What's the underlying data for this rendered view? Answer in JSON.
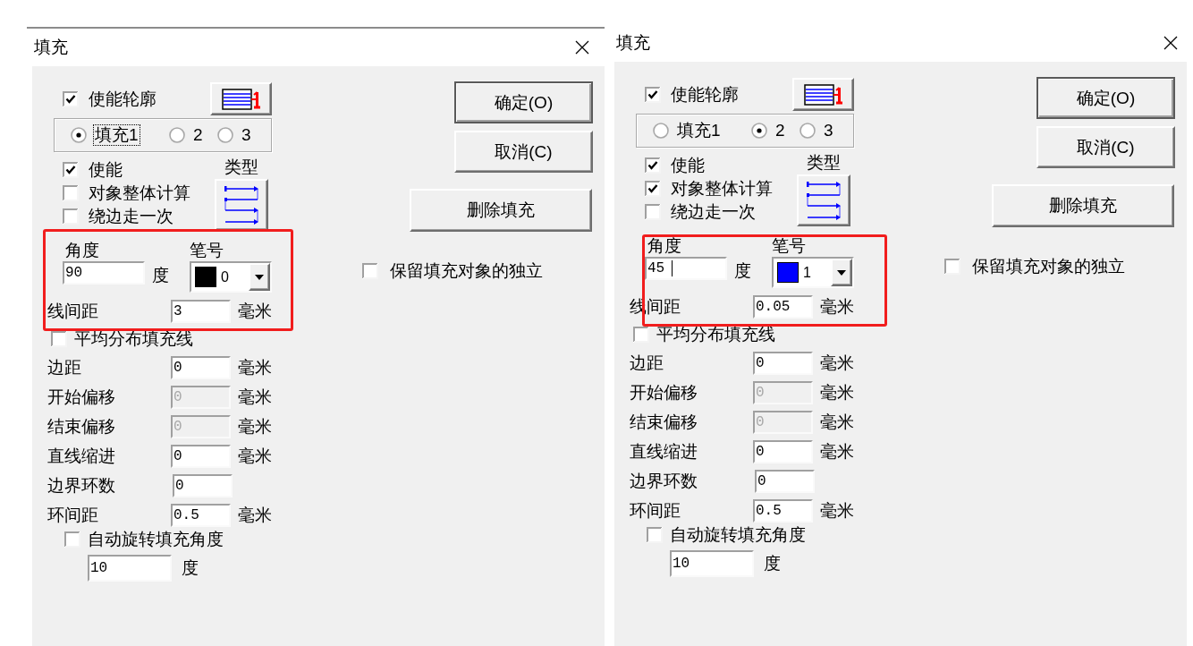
{
  "dialogs": [
    {
      "title": "填充",
      "outline": {
        "label": "使能轮廓",
        "checked": true
      },
      "fill_options": [
        {
          "label": "填充1",
          "selected": true,
          "focused": true
        },
        {
          "label": "2",
          "selected": false,
          "focused": false
        },
        {
          "label": "3",
          "selected": false,
          "focused": false
        }
      ],
      "options": [
        {
          "label": "使能",
          "checked": true
        },
        {
          "label": "对象整体计算",
          "checked": false
        },
        {
          "label": "绕边走一次",
          "checked": false
        }
      ],
      "type_label": "类型",
      "highlighted": true,
      "angle": {
        "label": "角度",
        "value": "90",
        "unit": "度",
        "focused": false
      },
      "pen": {
        "label": "笔号",
        "value": "0",
        "color": "#000000"
      },
      "line_spacing": {
        "label": "线间距",
        "value": "3",
        "unit": "毫米"
      },
      "even_distribution": {
        "label": "平均分布填充线",
        "checked": false
      },
      "fields": [
        {
          "label": "边距",
          "value": "0",
          "unit": "毫米",
          "disabled": false
        },
        {
          "label": "开始偏移",
          "value": "0",
          "unit": "毫米",
          "disabled": true
        },
        {
          "label": "结束偏移",
          "value": "0",
          "unit": "毫米",
          "disabled": true
        },
        {
          "label": "直线缩进",
          "value": "0",
          "unit": "毫米",
          "disabled": false
        },
        {
          "label": "边界环数",
          "value": "0",
          "disabled": false
        },
        {
          "label": "环间距",
          "value": "0.5",
          "unit": "毫米",
          "disabled": false
        }
      ],
      "auto_rotate": {
        "label": "自动旋转填充角度",
        "checked": false,
        "value": "10",
        "unit": "度"
      },
      "buttons": [
        {
          "label": "确定(O)",
          "default": true
        },
        {
          "label": "取消(C)",
          "default": false
        }
      ],
      "delete_button": "删除填充",
      "keep_independent": {
        "label": "保留填充对象的独立",
        "checked": false
      }
    },
    {
      "title": "填充",
      "outline": {
        "label": "使能轮廓",
        "checked": true
      },
      "fill_options": [
        {
          "label": "填充1",
          "selected": false,
          "focused": false
        },
        {
          "label": "2",
          "selected": true,
          "focused": false
        },
        {
          "label": "3",
          "selected": false,
          "focused": false
        }
      ],
      "options": [
        {
          "label": "使能",
          "checked": true
        },
        {
          "label": "对象整体计算",
          "checked": true
        },
        {
          "label": "绕边走一次",
          "checked": false
        }
      ],
      "type_label": "类型",
      "highlighted": true,
      "angle": {
        "label": "角度",
        "value": "45",
        "unit": "度",
        "focused": true
      },
      "pen": {
        "label": "笔号",
        "value": "1",
        "color": "#0000ff"
      },
      "line_spacing": {
        "label": "线间距",
        "value": "0.05",
        "unit": "毫米"
      },
      "even_distribution": {
        "label": "平均分布填充线",
        "checked": false
      },
      "fields": [
        {
          "label": "边距",
          "value": "0",
          "unit": "毫米",
          "disabled": false
        },
        {
          "label": "开始偏移",
          "value": "0",
          "unit": "毫米",
          "disabled": true
        },
        {
          "label": "结束偏移",
          "value": "0",
          "unit": "毫米",
          "disabled": true
        },
        {
          "label": "直线缩进",
          "value": "0",
          "unit": "毫米",
          "disabled": false
        },
        {
          "label": "边界环数",
          "value": "0",
          "disabled": false
        },
        {
          "label": "环间距",
          "value": "0.5",
          "unit": "毫米",
          "disabled": false
        }
      ],
      "auto_rotate": {
        "label": "自动旋转填充角度",
        "checked": false,
        "value": "10",
        "unit": "度"
      },
      "buttons": [
        {
          "label": "确定(O)",
          "default": true
        },
        {
          "label": "取消(C)",
          "default": false
        }
      ],
      "delete_button": "删除填充",
      "keep_independent": {
        "label": "保留填充对象的独立",
        "checked": false
      }
    }
  ]
}
